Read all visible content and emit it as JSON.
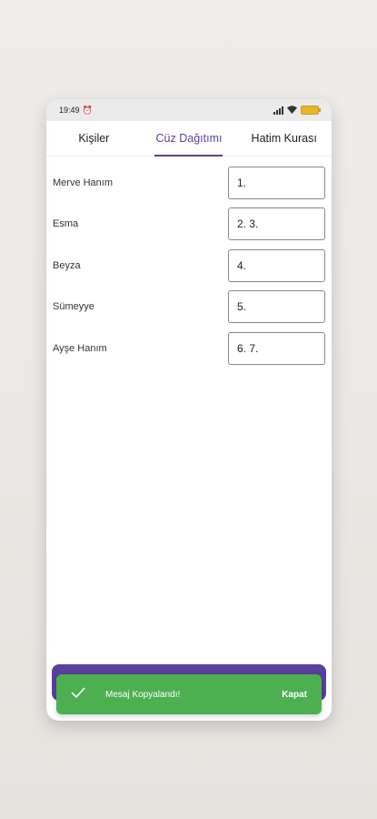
{
  "status_bar": {
    "time": "19:49",
    "alarm_icon": "alarm-clock-icon",
    "signal_icon": "cellular-signal-icon",
    "wifi_icon": "wifi-icon",
    "battery_icon": "battery-icon"
  },
  "tabs": [
    {
      "label": "Kişiler",
      "active": false
    },
    {
      "label": "Cüz Dağıtımı",
      "active": true
    },
    {
      "label": "Hatim Kurası",
      "active": false
    }
  ],
  "rows": [
    {
      "name": "Merve Hanım",
      "value": "1."
    },
    {
      "name": "Esma",
      "value": "2. 3."
    },
    {
      "name": "Beyza",
      "value": "4."
    },
    {
      "name": "Sümeyye",
      "value": "5."
    },
    {
      "name": "Ayşe Hanım",
      "value": "6. 7."
    }
  ],
  "snackbar": {
    "icon": "check-icon",
    "message": "Mesaj Kopyalandı!",
    "action": "Kapat"
  },
  "colors": {
    "accent": "#5b3f9c",
    "snackbar": "#4caf50"
  }
}
